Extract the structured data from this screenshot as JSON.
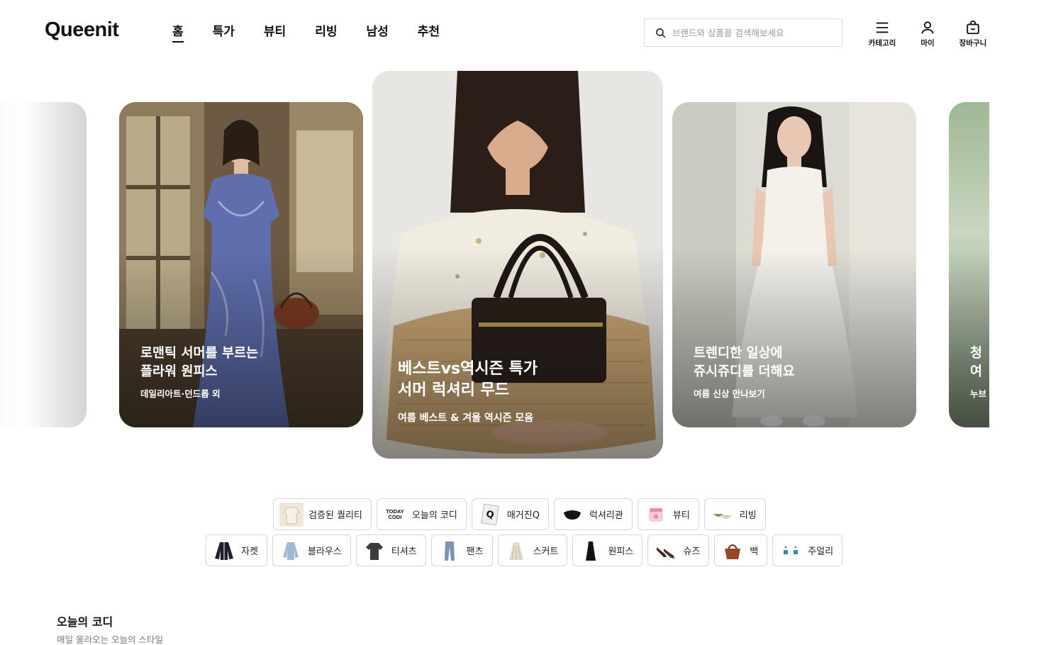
{
  "header": {
    "logo": "Queenit",
    "nav": [
      "홈",
      "특가",
      "뷰티",
      "리빙",
      "남성",
      "추천"
    ],
    "search_placeholder": "브랜드와 상품을 검색해보세요",
    "icons": {
      "category": "카테고리",
      "my": "마이",
      "cart": "장바구니"
    }
  },
  "carousel": {
    "cards": [
      {
        "title_line1": "로맨틱 서머를 부르는",
        "title_line2": "플라워 원피스",
        "subtitle": "데일리아트·던드롭 외"
      },
      {
        "title_line1": "베스트vs역시즌 특가",
        "title_line2": "서머 럭셔리 무드",
        "subtitle": "여름 베스트 & 겨울 역시즌 모음"
      },
      {
        "title_line1": "트렌디한 일상에",
        "title_line2": "쥬시쥬디를 더해요",
        "subtitle": "여름 신상 만나보기"
      },
      {
        "title_line1": "청",
        "title_line2": "여",
        "subtitle": "누브"
      }
    ]
  },
  "quick_menu": {
    "row1": [
      "검증된 퀄리티",
      "오늘의 코디",
      "매거진Q",
      "럭셔리관",
      "뷰티",
      "리빙"
    ],
    "row2": [
      "자켓",
      "블라우스",
      "티셔츠",
      "팬츠",
      "스커트",
      "원피스",
      "슈즈",
      "백",
      "주얼리"
    ],
    "today_codi_badge": "TODAY CODI",
    "magazine_badge": "Q"
  },
  "section": {
    "title": "오늘의 코디",
    "subtitle": "매일 올라오는 오늘의 스타일"
  }
}
